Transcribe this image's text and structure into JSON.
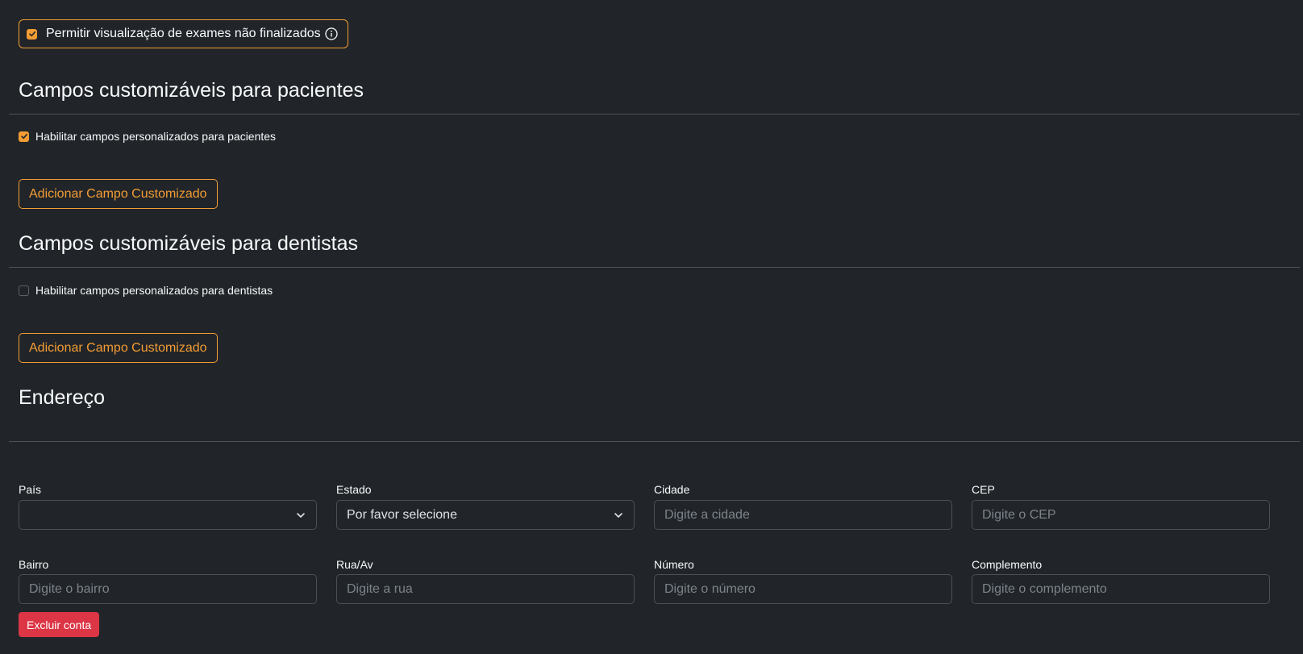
{
  "top_option": {
    "label": "Permitir visualização de exames não finalizados",
    "checked": true,
    "icon": "info-icon"
  },
  "patients_section": {
    "title": "Campos customizáveis para pacientes",
    "enable_label": "Habilitar campos personalizados para pacientes",
    "enabled": true,
    "add_button": "Adicionar Campo Customizado"
  },
  "dentists_section": {
    "title": "Campos customizáveis para dentistas",
    "enable_label": "Habilitar campos personalizados para dentistas",
    "enabled": false,
    "add_button": "Adicionar Campo Customizado"
  },
  "address": {
    "title": "Endereço",
    "country": {
      "label": "País",
      "value": ""
    },
    "state": {
      "label": "Estado",
      "value": "Por favor selecione"
    },
    "city": {
      "label": "Cidade",
      "placeholder": "Digite a cidade"
    },
    "zip": {
      "label": "CEP",
      "placeholder": "Digite o CEP"
    },
    "district": {
      "label": "Bairro",
      "placeholder": "Digite o bairro"
    },
    "street": {
      "label": "Rua/Av",
      "placeholder": "Digite a rua"
    },
    "number": {
      "label": "Número",
      "placeholder": "Digite o número"
    },
    "complement": {
      "label": "Complemento",
      "placeholder": "Digite o complemento"
    }
  },
  "delete_account_button": "Excluir conta",
  "colors": {
    "background": "#212529",
    "accent": "#f39c34",
    "danger": "#dc3545",
    "text": "#f8f9fa"
  }
}
